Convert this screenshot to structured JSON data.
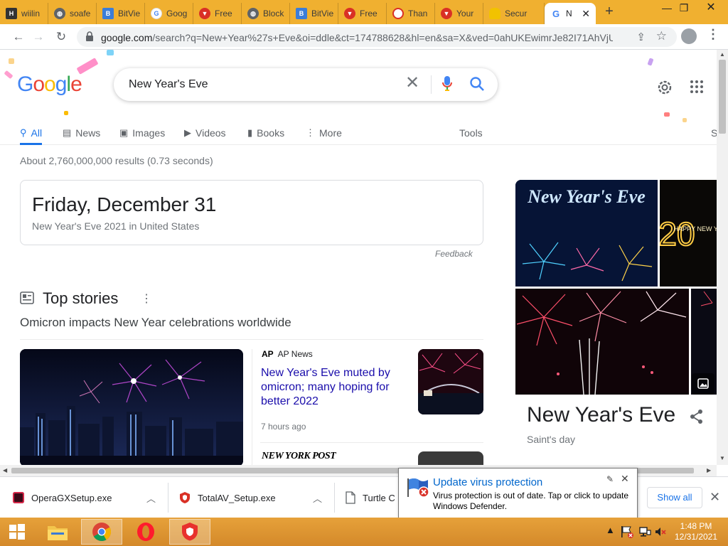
{
  "browser_tabs": [
    {
      "label": "wiilin",
      "icon": "hfs-favicon",
      "color": "#333333"
    },
    {
      "label": "soafe",
      "icon": "globe-favicon",
      "color": "#5f6368"
    },
    {
      "label": "BitVie",
      "icon": "bitview-favicon",
      "color": "#3b7dd8"
    },
    {
      "label": "Goog",
      "icon": "google-favicon",
      "color": "#4285f4"
    },
    {
      "label": "Free",
      "icon": "shield-favicon",
      "color": "#d93025"
    },
    {
      "label": "Block",
      "icon": "globe-favicon",
      "color": "#5f6368"
    },
    {
      "label": "BitVie",
      "icon": "bitview-favicon",
      "color": "#3b7dd8"
    },
    {
      "label": "Free",
      "icon": "shield-favicon",
      "color": "#d93025"
    },
    {
      "label": "Than",
      "icon": "opera-favicon",
      "color": "#d93025"
    },
    {
      "label": "Your",
      "icon": "shield-favicon",
      "color": "#d93025"
    },
    {
      "label": "Secur",
      "icon": "lock-favicon",
      "color": "#f2c200"
    }
  ],
  "active_tab": {
    "label": "N",
    "icon": "google-favicon"
  },
  "address_bar": {
    "host": "google.com",
    "path": "/search?q=New+Year%27s+Eve&oi=ddle&ct=174788628&hl=en&sa=X&ved=0ahUKEwimrJe82I71AhVjU..."
  },
  "search": {
    "query": "New Year's Eve"
  },
  "logo": {
    "letters": [
      "G",
      "o",
      "o",
      "g",
      "l",
      "e"
    ],
    "colors": [
      "#4285f4",
      "#ea4335",
      "#fbbc05",
      "#4285f4",
      "#34a853",
      "#ea4335"
    ]
  },
  "nav_tabs": [
    {
      "label": "All",
      "icon": "search-icon",
      "active": true
    },
    {
      "label": "News",
      "icon": "news-icon"
    },
    {
      "label": "Images",
      "icon": "image-icon"
    },
    {
      "label": "Videos",
      "icon": "video-icon"
    },
    {
      "label": "Books",
      "icon": "book-icon"
    },
    {
      "label": "More",
      "icon": "more-vert-icon"
    }
  ],
  "tools_label": "Tools",
  "result_stats": "About 2,760,000,000 results (0.73 seconds)",
  "date_card": {
    "date": "Friday, December 31",
    "subtitle": "New Year's Eve 2021 in United States"
  },
  "feedback_label": "Feedback",
  "top_stories": {
    "title": "Top stories",
    "headline": "Omicron impacts New Year celebrations worldwide",
    "story1": {
      "source_logo": "AP",
      "source": "AP News",
      "headline": "New Year's Eve muted by omicron; many hoping for better 2022",
      "time": "7 hours ago"
    },
    "story2": {
      "source_logo": "NEW YORK POST"
    }
  },
  "knowledge_panel": {
    "title": "New Year's Eve",
    "subtitle": "Saint's day",
    "image_text_1": "New Year's Eve",
    "image_text_2": "HAPPY NEW YEAR",
    "image_text_3": "20"
  },
  "downloads": [
    {
      "name": "OperaGXSetup.exe",
      "icon": "opera-gx-icon"
    },
    {
      "name": "TotalAV_Setup.exe",
      "icon": "totalav-shield-icon"
    },
    {
      "name": "Turtle C",
      "icon": "file-icon"
    }
  ],
  "show_all_label": "Show all",
  "toast": {
    "title": "Update virus protection",
    "body": "Virus protection is out of date. Tap or click to update Windows Defender."
  },
  "taskbar": {
    "time": "1:48 PM",
    "date": "12/31/2021",
    "apps": [
      "file-explorer-icon",
      "chrome-icon",
      "opera-icon",
      "totalav-icon"
    ]
  }
}
